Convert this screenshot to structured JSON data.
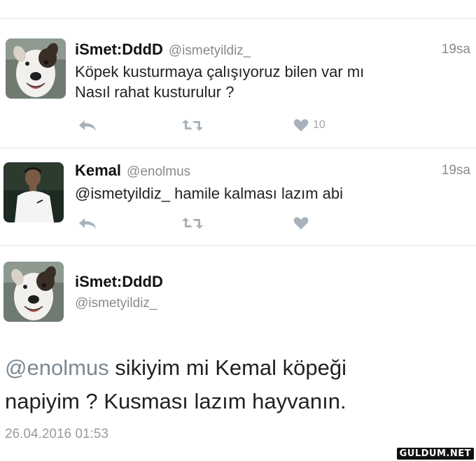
{
  "tweets": [
    {
      "name": "iSmet:DddD",
      "handle": "@ismetyildiz_",
      "time": "19sa",
      "text_line1": "Köpek kusturmaya çalışıyoruz bilen var mı",
      "text_line2": "Nasıl rahat kusturulur ?",
      "likes": "10",
      "avatar_icon": "dog-photo"
    },
    {
      "name": "Kemal",
      "handle": "@enolmus",
      "time": "19sa",
      "text": "@ismetyildiz_ hamile kalması lazım abi",
      "avatar_icon": "person-photo"
    }
  ],
  "detail": {
    "name": "iSmet:DddD",
    "handle": "@ismetyildiz_",
    "mention": "@enolmus",
    "text_line1_rest": " sikiyim mi Kemal köpeği",
    "text_line2": "napiyim ? Kusması lazım hayvanın.",
    "timestamp": "26.04.2016 01:53",
    "avatar_icon": "dog-photo"
  },
  "watermark": "GULDUM.NET",
  "icons": {
    "reply": "reply-icon",
    "retweet": "retweet-icon",
    "like": "heart-icon"
  },
  "colors": {
    "action_gray": "#a8b2bc",
    "mention_gray": "#7d8992",
    "meta_gray": "#8a8a8a"
  }
}
